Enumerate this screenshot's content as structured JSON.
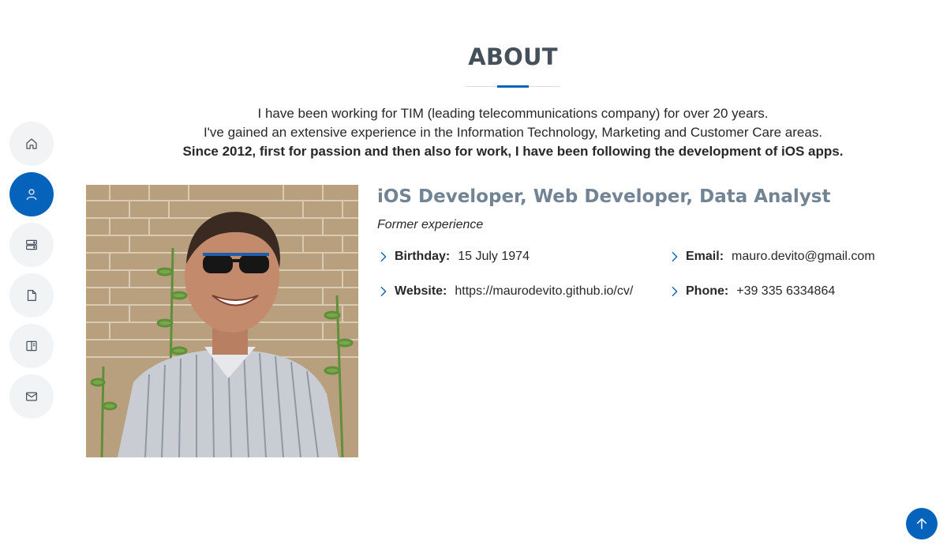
{
  "nav": {
    "items": [
      {
        "icon": "home-icon",
        "active": false
      },
      {
        "icon": "person-icon",
        "active": true
      },
      {
        "icon": "server-icon",
        "active": false
      },
      {
        "icon": "file-icon",
        "active": false
      },
      {
        "icon": "book-icon",
        "active": false
      },
      {
        "icon": "envelope-icon",
        "active": false
      }
    ]
  },
  "about": {
    "title": "ABOUT",
    "intro_line1": "I have been working for TIM (leading telecommunications company) for over 20 years.",
    "intro_line2": "I've gained an extensive experience in the Information Technology, Marketing and Customer Care areas.",
    "intro_line3": "Since 2012, first for passion and then also for work, I have been following the development of iOS apps."
  },
  "content": {
    "heading": "iOS Developer, Web Developer, Data Analyst",
    "subtitle": "Former experience",
    "birthday_label": "Birthday:",
    "birthday_value": "15 July 1974",
    "website_label": "Website:",
    "website_value": "https://maurodevito.github.io/cv/",
    "email_label": "Email:",
    "email_value": "mauro.devito@gmail.com",
    "phone_label": "Phone:",
    "phone_value": "+39 335 6334864"
  },
  "colors": {
    "accent": "#0563bb",
    "title": "#45505b",
    "heading": "#728394",
    "nav_bg": "#f2f3f5"
  }
}
